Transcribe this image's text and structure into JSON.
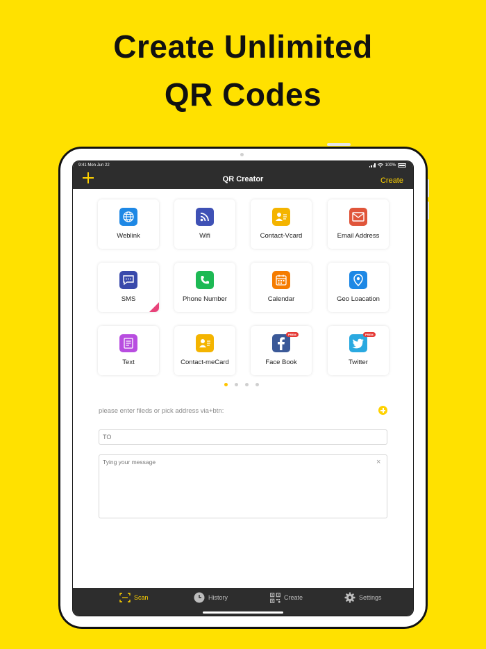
{
  "headline": {
    "line1": "Create Unlimited",
    "line2": "QR Codes"
  },
  "status": {
    "time": "9:41 Mon Jun 22",
    "battery": "100%"
  },
  "navbar": {
    "title": "QR Creator",
    "create_label": "Create"
  },
  "grid": {
    "items": [
      {
        "label": "Weblink",
        "icon": "globe-icon",
        "color": "#1E88E5"
      },
      {
        "label": "Wifi",
        "icon": "wifi-icon",
        "color": "#3F51B5"
      },
      {
        "label": "Contact-Vcard",
        "icon": "contact-card-icon",
        "color": "#F4B400"
      },
      {
        "label": "Email Address",
        "icon": "envelope-icon",
        "color": "#E0553A"
      },
      {
        "label": "SMS",
        "icon": "chat-bubble-icon",
        "color": "#3949AB"
      },
      {
        "label": "Phone Number",
        "icon": "phone-icon",
        "color": "#1DB954"
      },
      {
        "label": "Calendar",
        "icon": "calendar-icon",
        "color": "#F57C00"
      },
      {
        "label": "Geo Loacation",
        "icon": "map-pin-icon",
        "color": "#1E88E5"
      },
      {
        "label": "Text",
        "icon": "document-icon",
        "color": "#B84DE0"
      },
      {
        "label": "Contact-meCard",
        "icon": "contact-card-icon",
        "color": "#F4B400"
      },
      {
        "label": "Face Book",
        "icon": "facebook-icon",
        "color": "#3B5998",
        "badge": "PREM"
      },
      {
        "label": "Twitter",
        "icon": "twitter-icon",
        "color": "#2AA9E0",
        "badge": "PREM"
      }
    ]
  },
  "pagination": {
    "count": 4,
    "active": 0
  },
  "form": {
    "hint": "please enter fileds or pick address via+btn:",
    "to_placeholder": "TO",
    "message_placeholder": "Tying your message"
  },
  "tabbar": {
    "items": [
      {
        "label": "Scan",
        "icon": "scan-icon",
        "active": true
      },
      {
        "label": "History",
        "icon": "clock-icon",
        "active": false
      },
      {
        "label": "Create",
        "icon": "qr-code-icon",
        "active": false
      },
      {
        "label": "Settings",
        "icon": "gear-icon",
        "active": false
      }
    ]
  },
  "colors": {
    "accent": "#FFD200",
    "background": "#FFE100",
    "bar": "#2D2D2D"
  }
}
